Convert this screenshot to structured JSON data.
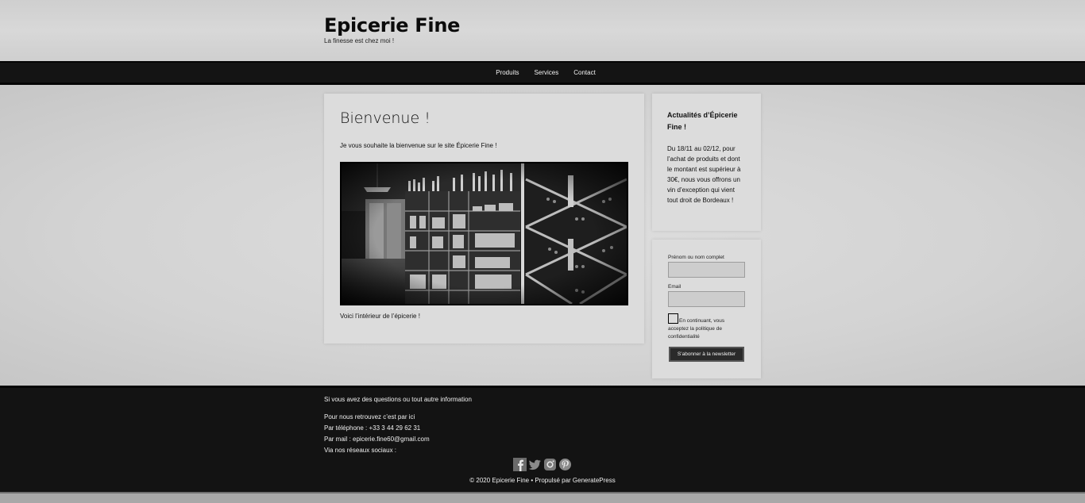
{
  "site": {
    "title": "Epicerie Fine",
    "tagline": "La finesse est chez moi !"
  },
  "nav": {
    "items": [
      "Produits",
      "Services",
      "Contact"
    ]
  },
  "main": {
    "heading": "Bienvenue !",
    "welcome": "Je vous souhaite la bienvenue sur le site Épicerie Fine !",
    "caption": "Voici l’intérieur de l’épicerie !"
  },
  "sidebar": {
    "news_title": "Actualités d’Épicerie Fine !",
    "news_body": "Du 18/11 au 02/12, pour l’achat de produits et dont le montant est supérieur à 30€, nous vous offrons un vin d’exception qui vient tout droit de Bordeaux !",
    "form": {
      "name_label": "Prénom ou nom complet",
      "email_label": "Email",
      "consent_text": "En continuant, vous acceptez la politique de confidentialité",
      "subscribe_label": "S’abonner à la newsletter"
    }
  },
  "footer": {
    "questions": "Si vous avez des questions ou tout autre information",
    "find_us": "Pour nous retrouvez c’est par ici",
    "phone": "Par téléphone : +33 3 44 29 62 31",
    "mail": "Par mail : epicerie.fine60@gmail.com",
    "social": "Via nos réseaux sociaux :",
    "copyright": "© 2020 Epicerie Fine • Propulsé par GeneratePress"
  },
  "social_icons": [
    "facebook-icon",
    "twitter-icon",
    "instagram-icon",
    "pinterest-icon"
  ]
}
